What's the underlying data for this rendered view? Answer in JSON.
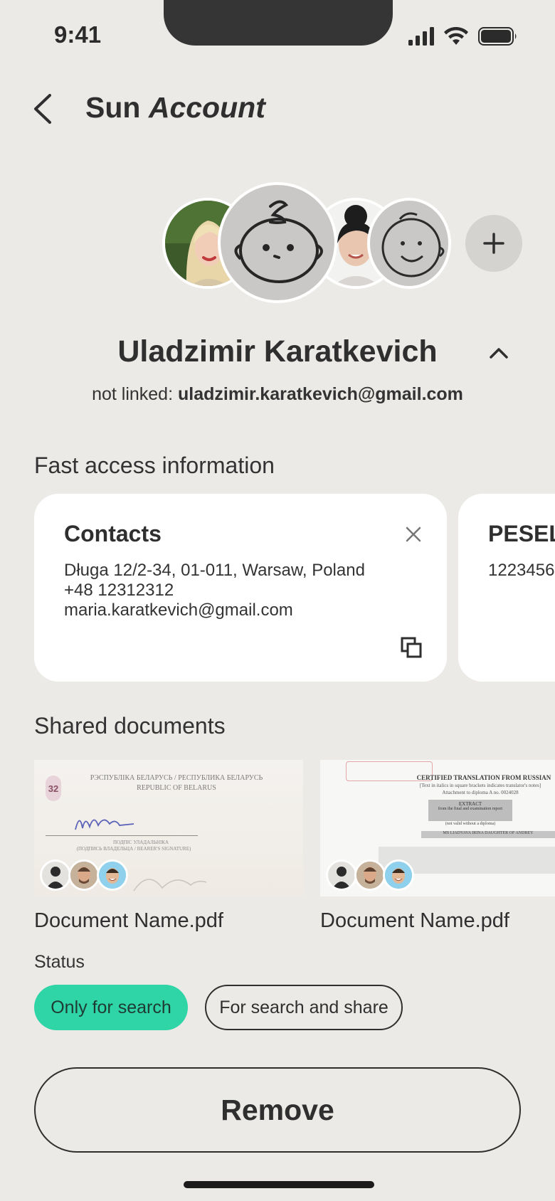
{
  "status_bar": {
    "time": "9:41",
    "icons": [
      "signal-icon",
      "wifi-icon",
      "battery-icon"
    ]
  },
  "header": {
    "title_part1": "Sun",
    "title_part2": "Account"
  },
  "profiles": {
    "avatars": [
      "avatar-blonde-woman",
      "avatar-baby-drawing-selected",
      "avatar-woman-bun",
      "avatar-smiley-drawing"
    ],
    "add_icon": "plus-icon"
  },
  "user": {
    "name": "Uladzimir Karatkevich",
    "linked_prefix": "not linked:",
    "email": "uladzimir.karatkevich@gmail.com"
  },
  "fast_access": {
    "title": "Fast access information",
    "cards": [
      {
        "title": "Contacts",
        "lines": [
          "Długa 12/2-34, 01-011, Warsaw, Poland",
          "+48 12312312",
          "maria.karatkevich@gmail.com"
        ]
      },
      {
        "title": "PESEL",
        "lines": [
          "1223456"
        ]
      }
    ]
  },
  "shared_documents": {
    "title": "Shared documents",
    "docs": [
      {
        "name": "Document Name.pdf",
        "thumb_lines": [
          "РЭСПУБЛІКА БЕЛАРУСЬ / РЕСПУБЛИКА БЕЛАРУСЬ",
          "REPUBLIC OF BELARUS",
          "ПОДПІС УЛАДАЛЬНІКА",
          "(ПОДПИСЬ ВЛАДЕЛЬЦА / BEARER'S SIGNATURE)",
          "32"
        ]
      },
      {
        "name": "Document Name.pdf",
        "thumb_lines": [
          "CERTIFIED TRANSLATION FROM RUSSIAN",
          "[Text in italics in square brackets indicates translator's notes]",
          "Attachment to diploma A no. 0024028",
          "EXTRACT",
          "from the final and examination report",
          "(not valid without a diploma)",
          "MS LIADYAVA IRINA DAUGHTER OF ANDREY"
        ]
      }
    ]
  },
  "status": {
    "label": "Status",
    "options": [
      "Only for search",
      "For search and share"
    ],
    "selected": "Only for search"
  },
  "actions": {
    "remove_label": "Remove"
  },
  "colors": {
    "background": "#ebeae7",
    "accent": "#2fd4a7",
    "text": "#2f2f2f",
    "notch": "#353535"
  }
}
